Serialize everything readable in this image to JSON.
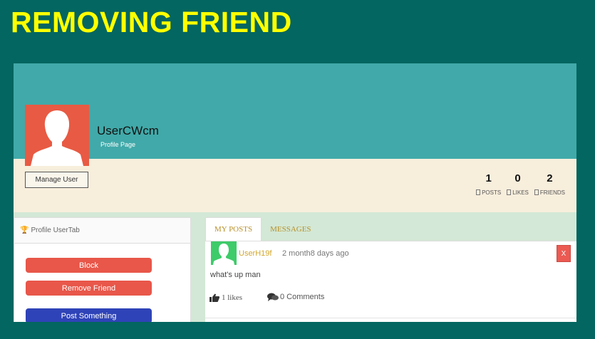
{
  "banner": {
    "title": "REMOVING FRIEND"
  },
  "profile": {
    "username": "UserCWcm",
    "subtitle": "Profile Page",
    "manage_label": "Manage User",
    "stats": [
      {
        "value": "1",
        "label": "POSTS"
      },
      {
        "value": "0",
        "label": "LIKES"
      },
      {
        "value": "2",
        "label": "FRIENDS"
      }
    ]
  },
  "sidebar": {
    "header": "Profile UserTab",
    "block_label": "Block",
    "remove_friend_label": "Remove Friend",
    "post_something_label": "Post Something"
  },
  "tabs": [
    {
      "label": "MY POSTS",
      "active": true
    },
    {
      "label": "MESSAGES",
      "active": false
    }
  ],
  "post": {
    "user": "UserH19f",
    "time": "2 month8 days ago",
    "close_label": "X",
    "text": "what's up man",
    "likes": "1 likes",
    "comments": "0 Comments"
  },
  "colors": {
    "background": "#036660",
    "banner_text": "#ffff00",
    "cover": "#41a9a9",
    "strip": "#f8eedc",
    "danger": "#e8574a",
    "primary": "#2f43b8",
    "link": "#d4a72c"
  }
}
